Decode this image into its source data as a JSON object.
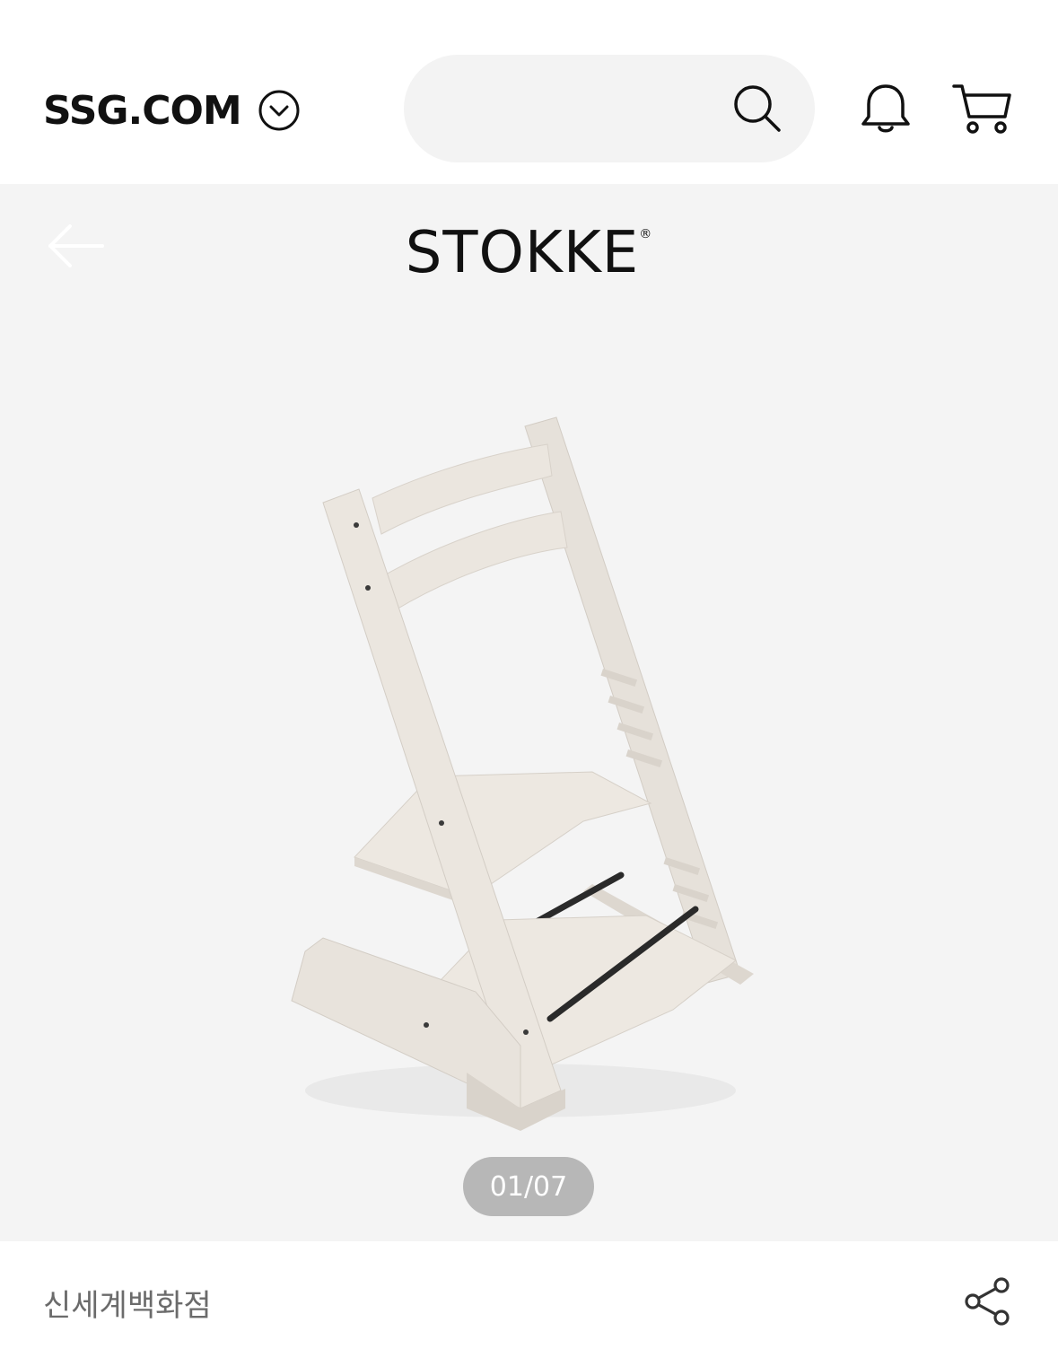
{
  "header": {
    "logo": "SSG.COM",
    "logo_chevron_icon": "chevron-down-circle-icon",
    "search": {
      "value": "",
      "icon": "search-icon"
    },
    "notification_icon": "bell-icon",
    "cart_icon": "cart-icon"
  },
  "gallery": {
    "back_icon": "arrow-left-icon",
    "brand": "STOKKE",
    "brand_mark": "®",
    "image_alt": "Stokke Tripp Trapp chair",
    "counter": "01/07"
  },
  "seller": {
    "name": "신세계백화점",
    "share_icon": "share-icon"
  },
  "colors": {
    "header_bg": "#ffffff",
    "search_bg": "#f3f3f3",
    "gallery_bg": "#f4f4f4",
    "counter_bg": "#b7b7b7",
    "text_primary": "#111111",
    "text_secondary": "#6b6b6b",
    "chair_wood": "#e8e3dc"
  }
}
